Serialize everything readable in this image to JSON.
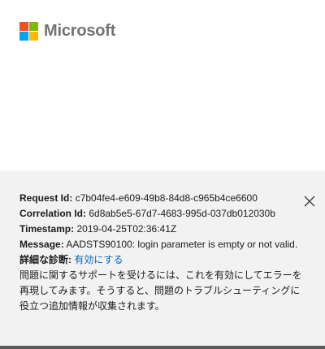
{
  "brand": {
    "name": "Microsoft"
  },
  "error": {
    "request_id_label": "Request Id:",
    "request_id": "c7b04fe4-e609-49b8-84d8-c965b4ce6600",
    "correlation_id_label": "Correlation Id:",
    "correlation_id": "6d8ab5e5-67d7-4683-995d-037db012030b",
    "timestamp_label": "Timestamp:",
    "timestamp": "2019-04-25T02:36:41Z",
    "message_label": "Message:",
    "message": "AADSTS90100: login parameter is empty or not valid.",
    "diagnostics_label": "詳細な診断:",
    "diagnostics_link": "有効にする",
    "diagnostics_note": "問題に関するサポートを受けるには、これを有効にしてエラーを再現してみます。そうすると、問題のトラブルシューティングに役立つ追加情報が収集されます。"
  },
  "icons": {
    "close": "close-icon",
    "logo": "microsoft-logo-icon"
  },
  "colors": {
    "panel_bg": "#f2f2f2",
    "link": "#0067b8",
    "logo_red": "#f25022",
    "logo_green": "#7fba00",
    "logo_blue": "#00a4ef",
    "logo_yellow": "#ffb900"
  }
}
